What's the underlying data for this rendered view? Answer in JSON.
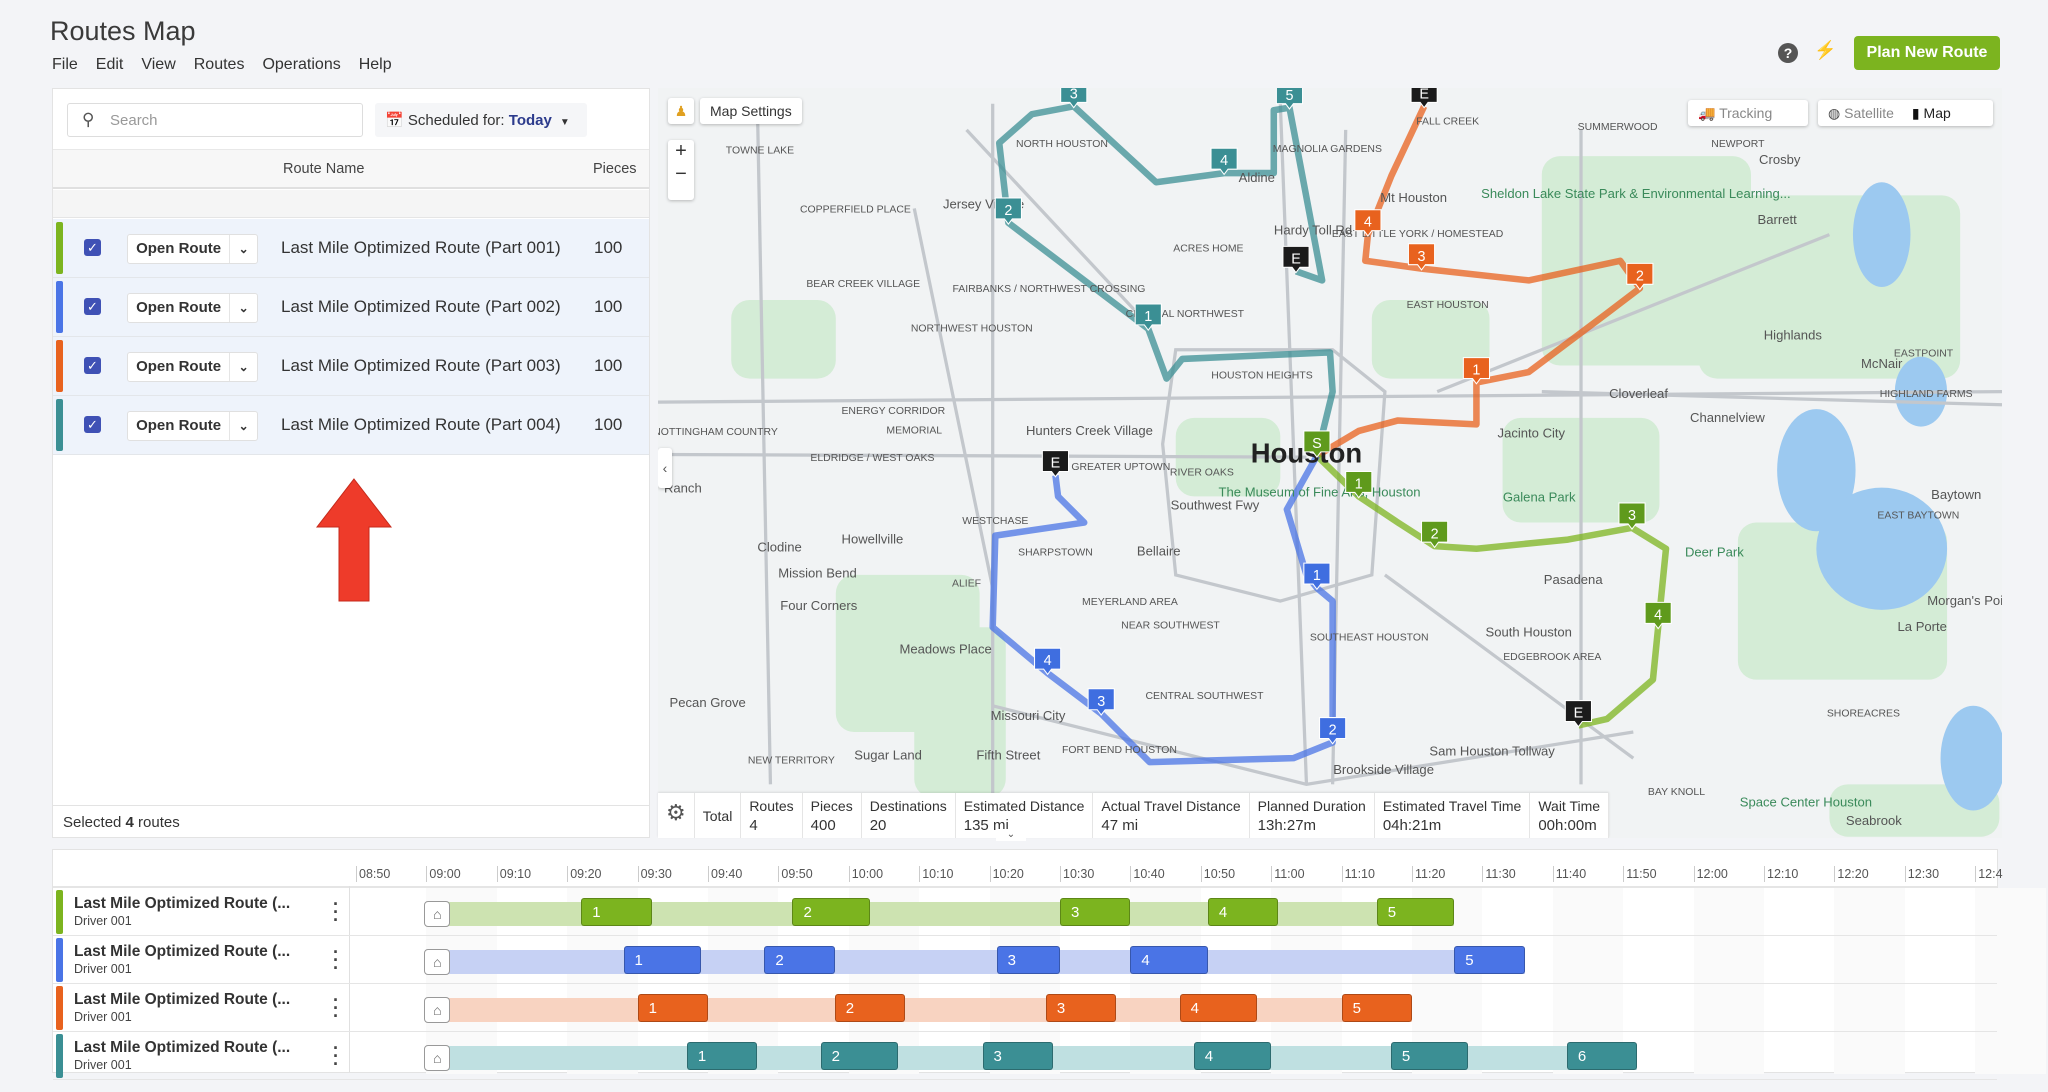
{
  "app": {
    "title": "Routes Map",
    "menu": [
      "File",
      "Edit",
      "View",
      "Routes",
      "Operations",
      "Help"
    ],
    "plan_button": "Plan New Route",
    "help_icon": "?",
    "bolt_icon": "⚡"
  },
  "colors": {
    "green": "#7cb41f",
    "blue": "#4a74e6",
    "orange": "#e8621e",
    "teal": "#3b8f94",
    "accent": "#3f51b5"
  },
  "left_panel": {
    "search_placeholder": "Search",
    "scheduled_label": "Scheduled for: ",
    "scheduled_value": "Today",
    "col_route_name": "Route Name",
    "col_pieces": "Pieces",
    "routes": [
      {
        "name": "Last Mile Optimized Route (Part 001)",
        "pieces": "100",
        "color": "#7cb41f",
        "checked": true,
        "button": "Open Route"
      },
      {
        "name": "Last Mile Optimized Route (Part 002)",
        "pieces": "100",
        "color": "#4a74e6",
        "checked": true,
        "button": "Open Route"
      },
      {
        "name": "Last Mile Optimized Route (Part 003)",
        "pieces": "100",
        "color": "#e8621e",
        "checked": true,
        "button": "Open Route"
      },
      {
        "name": "Last Mile Optimized Route (Part 004)",
        "pieces": "100",
        "color": "#3b8f94",
        "checked": true,
        "button": "Open Route"
      }
    ],
    "footer_prefix": "Selected ",
    "footer_count": "4",
    "footer_suffix": " routes"
  },
  "map": {
    "settings": "Map Settings",
    "tracking": "Tracking",
    "satellite": "Satellite",
    "map": "Map",
    "zoom_in": "+",
    "zoom_out": "−",
    "city": "Houston",
    "labels": [
      "TOWNE LAKE",
      "COPPERFIELD PLACE",
      "Jersey Village",
      "NORTH HOUSTON",
      "ACRES HOME",
      "BEAR CREEK VILLAGE",
      "FAIRBANKS / NORTHWEST CROSSING",
      "NORTHWEST HOUSTON",
      "CENTRAL NORTHWEST",
      "HOUSTON HEIGHTS",
      "Aldine",
      "MAGNOLIA GARDENS",
      "FALL CREEK",
      "SUMMERWOOD",
      "NEWPORT",
      "Crosby",
      "Mt Houston",
      "EAST LITTLE YORK / HOMESTEAD",
      "Sheldon Lake State Park & Environmental Learning...",
      "Barrett",
      "EAST HOUSTON",
      "Highlands",
      "EASTPOINT",
      "McNair",
      "HIGHLAND FARMS",
      "Cloverleaf",
      "Channelview",
      "Jacinto City",
      "NOTTINGHAM COUNTRY",
      "ENERGY CORRIDOR",
      "MEMORIAL",
      "ELDRIDGE / WEST OAKS",
      "Hunters Creek Village",
      "GREATER UPTOWN",
      "RIVER OAKS",
      "Galena Park",
      "Baytown",
      "EAST BAYTOWN",
      "Deer Park",
      "Pasadena",
      "Morgan's Point",
      "La Porte",
      "Ranch",
      "WESTCHASE",
      "SHARPSTOWN",
      "Bellaire",
      "Clodine",
      "Howellville",
      "Mission Bend",
      "ALIEF",
      "Four Corners",
      "MEYERLAND AREA",
      "NEAR SOUTHWEST",
      "SOUTHEAST HOUSTON",
      "South Houston",
      "EDGEBROOK AREA",
      "Meadows Place",
      "CENTRAL SOUTHWEST",
      "Pecan Grove",
      "Missouri City",
      "FORT BEND HOUSTON",
      "Fifth Street",
      "Sugar Land",
      "NEW TERRITORY",
      "Brookside Village",
      "Sam Houston Tollway",
      "BAY KNOLL",
      "Space Center Houston",
      "Seabrook",
      "SHOREACRES",
      "The Museum of Fine Arts, Houston",
      "Southwest Fwy",
      "Hardy Toll Rd"
    ]
  },
  "stats": {
    "total": "Total",
    "items": [
      {
        "label": "Routes",
        "value": "4"
      },
      {
        "label": "Pieces",
        "value": "400"
      },
      {
        "label": "Destinations",
        "value": "20"
      },
      {
        "label": "Estimated Distance",
        "value": "135 mi"
      },
      {
        "label": "Actual Travel Distance",
        "value": "47 mi"
      },
      {
        "label": "Planned Duration",
        "value": "13h:27m"
      },
      {
        "label": "Estimated Travel Time",
        "value": "04h:21m"
      },
      {
        "label": "Wait Time",
        "value": "00h:00m"
      }
    ]
  },
  "timeline": {
    "ticks": [
      "08:50",
      "09:00",
      "09:10",
      "09:20",
      "09:30",
      "09:40",
      "09:50",
      "10:00",
      "10:10",
      "10:20",
      "10:30",
      "10:40",
      "10:50",
      "11:00",
      "11:10",
      "11:20",
      "11:30",
      "11:40",
      "11:50",
      "12:00",
      "12:10",
      "12:20",
      "12:30",
      "12:4"
    ],
    "rows": [
      {
        "name": "Last Mile Optimized Route (...",
        "driver": "Driver 001",
        "color": "#7cb41f",
        "light": "#cde3b1",
        "start": "09:00",
        "end": "11:26",
        "stops": [
          [
            "1",
            "09:22",
            "09:32"
          ],
          [
            "2",
            "09:52",
            "10:03"
          ],
          [
            "3",
            "10:30",
            "10:40"
          ],
          [
            "4",
            "10:51",
            "11:01"
          ],
          [
            "5",
            "11:15",
            "11:26"
          ]
        ]
      },
      {
        "name": "Last Mile Optimized Route (...",
        "driver": "Driver 001",
        "color": "#4a74e6",
        "light": "#c6d1f4",
        "start": "09:00",
        "end": "11:36",
        "stops": [
          [
            "1",
            "09:28",
            "09:39"
          ],
          [
            "2",
            "09:48",
            "09:58"
          ],
          [
            "3",
            "10:21",
            "10:30"
          ],
          [
            "4",
            "10:40",
            "10:51"
          ],
          [
            "5",
            "11:26",
            "11:36"
          ]
        ]
      },
      {
        "name": "Last Mile Optimized Route (...",
        "driver": "Driver 001",
        "color": "#e8621e",
        "light": "#f8d3c1",
        "start": "09:00",
        "end": "11:20",
        "stops": [
          [
            "1",
            "09:30",
            "09:40"
          ],
          [
            "2",
            "09:58",
            "10:08"
          ],
          [
            "3",
            "10:28",
            "10:38"
          ],
          [
            "4",
            "10:47",
            "10:58"
          ],
          [
            "5",
            "11:10",
            "11:20"
          ]
        ]
      },
      {
        "name": "Last Mile Optimized Route (...",
        "driver": "Driver 001",
        "color": "#3b8f94",
        "light": "#bfe0e1",
        "start": "09:00",
        "end": "11:52",
        "stops": [
          [
            "1",
            "09:37",
            "09:47"
          ],
          [
            "2",
            "09:56",
            "10:07"
          ],
          [
            "3",
            "10:19",
            "10:29"
          ],
          [
            "4",
            "10:49",
            "11:00"
          ],
          [
            "5",
            "11:17",
            "11:28"
          ],
          [
            "6",
            "11:42",
            "11:52"
          ]
        ]
      }
    ]
  }
}
